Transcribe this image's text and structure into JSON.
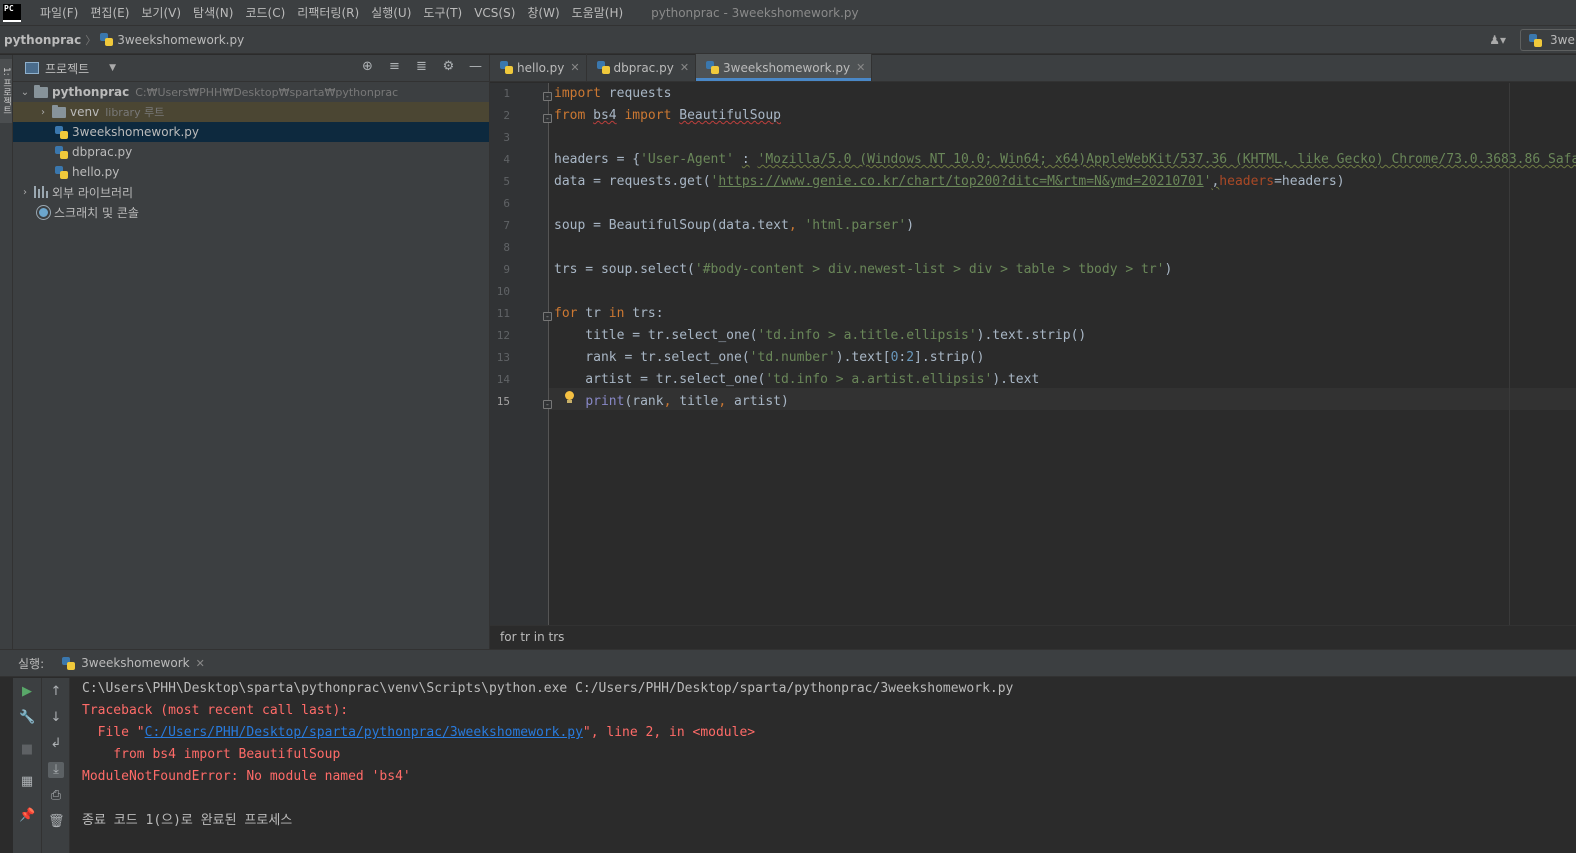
{
  "menu": {
    "items": [
      "파일(F)",
      "편집(E)",
      "보기(V)",
      "탐색(N)",
      "코드(C)",
      "리팩터링(R)",
      "실행(U)",
      "도구(T)",
      "VCS(S)",
      "창(W)",
      "도움말(H)"
    ],
    "window_title": "pythonprac - 3weekshomework.py"
  },
  "navbar": {
    "project": "pythonprac",
    "separator": "〉",
    "file": "3weekshomework.py",
    "run_config": "3we",
    "user_icon": "user-dropdown-icon"
  },
  "left_strip": {
    "tab_label": "1: 프로젝트"
  },
  "project_panel": {
    "title": "프로젝트",
    "tree": [
      {
        "label": "pythonprac",
        "hint": "C:₩Users₩PHH₩Desktop₩sparta₩pythonprac",
        "type": "folder",
        "depth": 0,
        "expanded": true,
        "bold": true
      },
      {
        "label": "venv",
        "hint": "library 루트",
        "type": "folder",
        "depth": 1,
        "expanded": false,
        "excluded": true
      },
      {
        "label": "3weekshomework.py",
        "hint": "",
        "type": "py",
        "depth": 1,
        "selected": true
      },
      {
        "label": "dbprac.py",
        "hint": "",
        "type": "py",
        "depth": 1
      },
      {
        "label": "hello.py",
        "hint": "",
        "type": "py",
        "depth": 1
      },
      {
        "label": "외부 라이브러리",
        "hint": "",
        "type": "lib",
        "depth": 0,
        "expanded": false
      },
      {
        "label": "스크래치 및 콘솔",
        "hint": "",
        "type": "scratch",
        "depth": 0
      }
    ]
  },
  "editor": {
    "tabs": [
      {
        "label": "hello.py",
        "active": false
      },
      {
        "label": "dbprac.py",
        "active": false
      },
      {
        "label": "3weekshomework.py",
        "active": true
      }
    ],
    "current_line": 15,
    "line_count": 15,
    "breadcrumb": "for tr in trs"
  },
  "run_panel": {
    "label": "실행:",
    "tab": "3weekshomework",
    "console": [
      "C:\\Users\\PHH\\Desktop\\sparta\\pythonprac\\venv\\Scripts\\python.exe C:/Users/PHH/Desktop/sparta/pythonprac/3weekshomework.py",
      "Traceback (most recent call last):",
      "  File \"",
      "C:/Users/PHH/Desktop/sparta/pythonprac/3weekshomework.py",
      "\", line 2, in <module>",
      "    from bs4 import BeautifulSoup",
      "ModuleNotFoundError: No module named 'bs4'",
      "종료 코드 1(으)로 완료된 프로세스"
    ]
  },
  "colors": {
    "keyword": "#cc7832",
    "string": "#6a8759",
    "number": "#6897bb",
    "builtin": "#8888c6",
    "error": "#ff6b68",
    "link": "#287bde",
    "selection": "#0d293e",
    "tab_accent": "#4a88c7"
  }
}
